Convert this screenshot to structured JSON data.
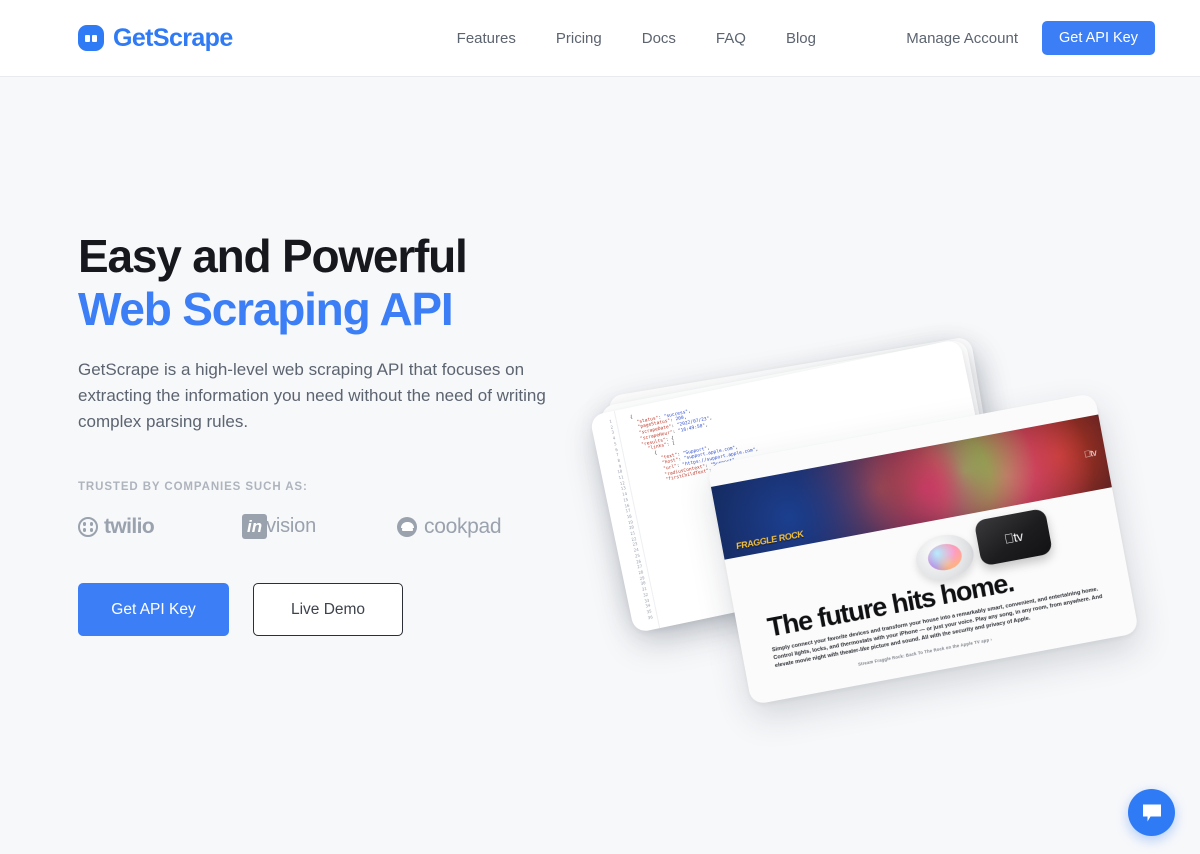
{
  "brand": {
    "name": "GetScrape",
    "mark_icon": "getscrape-logo-icon"
  },
  "header": {
    "nav": [
      {
        "label": "Features"
      },
      {
        "label": "Pricing"
      },
      {
        "label": "Docs"
      },
      {
        "label": "FAQ"
      },
      {
        "label": "Blog"
      }
    ],
    "manage_account_label": "Manage Account",
    "get_api_key_label": "Get API Key"
  },
  "hero": {
    "title_line1": "Easy and Powerful",
    "title_line2": "Web Scraping API",
    "subtitle": "GetScrape is a high-level web scraping API that focuses on extracting the information you need without the need of writing complex parsing rules.",
    "trusted_label": "TRUSTED BY COMPANIES SUCH AS:",
    "logos": [
      {
        "name": "twilio",
        "text": "twilio"
      },
      {
        "name": "invision",
        "mark": "in",
        "text": "vision"
      },
      {
        "name": "cookpad",
        "text": "cookpad"
      }
    ],
    "primary_cta": "Get API Key",
    "secondary_cta": "Live Demo"
  },
  "illustration": {
    "code_lines": "  {\n    \"status\": \"success\",\n    \"pageStatus\": 200,\n    \"scrapeDate\": \"2022/07/23\",\n    \"scrapeHour\": \"16:49:50\",\n    \"results\": {\n      \"links\": [\n        {\n          \"text\": \"Support\",\n          \"host\": \"support.apple.com\",\n          \"url\": \"https://support.apple.com\",\n          \"radiusContext\": \"Support\",\n          \"firstChildText\": \"Support\",",
    "gutter_numbers": "1 2 3 4 5 6 7 8 9 10 11 12 13 14 15 16 17 18 19 20 21 22 23 24 25 26 27 28 29 30 31 32 33 34 35 36",
    "banner_show_title": "FRAGGLE ROCK",
    "banner_service_logo": "tv",
    "device_label": "tv",
    "photo_headline": "The future hits home.",
    "photo_body": "Simply connect your favorite devices and transform your house into a remarkably smart, convenient, and entertaining home. Control lights, locks, and thermostats with your iPhone — or just your voice. Play any song, in any room, from anywhere. And elevate movie night with theater-like picture and sound. All with the security and privacy of Apple.",
    "photo_footnote": "Stream Fraggle Rock: Back To The Rock on the Apple TV app ›"
  },
  "chat": {
    "label": "chat-bubble-icon"
  },
  "colors": {
    "brand_blue": "#2f7af5",
    "cta_blue": "#3b7ef5",
    "page_background": "#f7f8fa",
    "header_background": "#ffffff",
    "muted_text": "#5c6470",
    "logo_gray": "#9aa2ae"
  }
}
